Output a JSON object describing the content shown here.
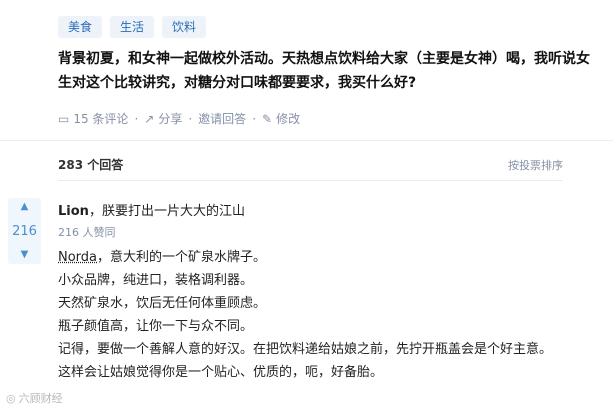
{
  "tags": [
    "美食",
    "生活",
    "饮料"
  ],
  "question": {
    "text": "背景初夏，和女神一起做校外活动。天热想点饮料给大家（主要是女神）喝，我听说女生对这个比较讲究，对糖分对口味都要要求，我买什么好?"
  },
  "actions": {
    "comments": "15 条评论",
    "share": "分享",
    "invite": "邀请回答",
    "edit": "修改"
  },
  "answers_bar": {
    "count": "283 个回答",
    "sort": "按投票排序"
  },
  "answer": {
    "votes": "216",
    "author_name": "Lion",
    "author_bio": "，朕要打出一片大大的江山",
    "agree_count": "216 人赞同",
    "link_word": "Norda",
    "line1_rest": "，意大利的一个矿泉水牌子。",
    "lines": [
      "小众品牌，纯进口，装格调利器。",
      "天然矿泉水，饮后无任何体重顾虑。",
      "瓶子颜值高，让你一下与众不同。",
      "记得，要做一个善解人意的好汉。在把饮料递给姑娘之前，先拧开瓶盖会是个好主意。",
      "这样会让姑娘觉得你是一个贴心、优质的，呃，好备胎。"
    ]
  },
  "watermark": "六顾财经",
  "colors": {
    "tag_bg": "#eef3fa",
    "tag_text": "#2a6cb8",
    "meta_gray": "#8590a6",
    "vote_bg": "#eff6fc",
    "vote_text": "#4b8ed1"
  }
}
